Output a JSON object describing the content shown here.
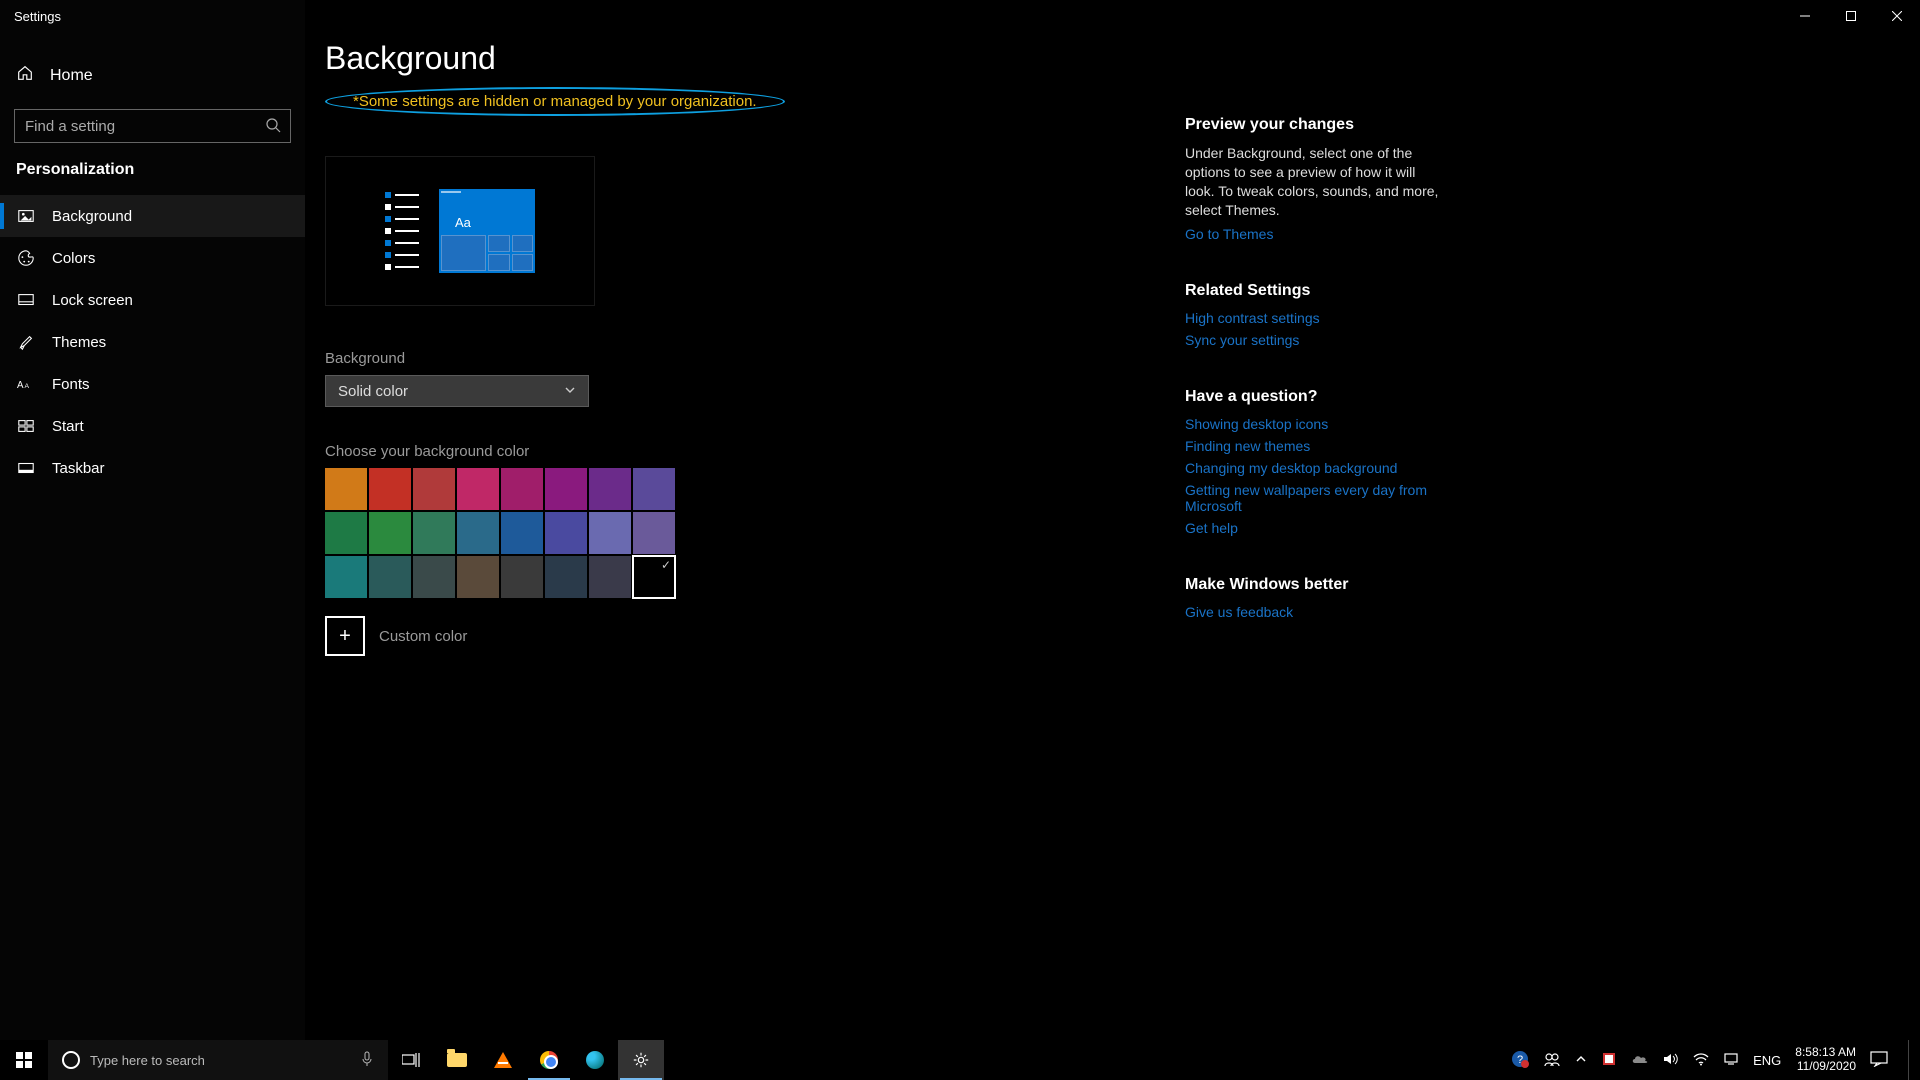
{
  "window": {
    "title": "Settings"
  },
  "sidebar": {
    "home": "Home",
    "search_placeholder": "Find a setting",
    "section": "Personalization",
    "items": [
      {
        "label": "Background"
      },
      {
        "label": "Colors"
      },
      {
        "label": "Lock screen"
      },
      {
        "label": "Themes"
      },
      {
        "label": "Fonts"
      },
      {
        "label": "Start"
      },
      {
        "label": "Taskbar"
      }
    ]
  },
  "main": {
    "title": "Background",
    "org_warning": "*Some settings are hidden or managed by your organization.",
    "preview_sample": "Aa",
    "bg_label": "Background",
    "bg_value": "Solid color",
    "swatch_label": "Choose your background color",
    "swatches": [
      "#d17a18",
      "#c33025",
      "#b03a3a",
      "#c02867",
      "#a01e6a",
      "#8a1a7e",
      "#6b2b8a",
      "#5a4a9a",
      "#1e7a45",
      "#2b8a3e",
      "#307a5a",
      "#2a6a8a",
      "#1e5a9a",
      "#4a4aa0",
      "#6a6ab0",
      "#6a5a9a",
      "#1a7a7a",
      "#2a5a5a",
      "#3a4a4a",
      "#5a4a3a",
      "#3a3a3a",
      "#2a3a4a",
      "#3a3a4a",
      "#000000"
    ],
    "selected_swatch_index": 23,
    "custom_color": "Custom color"
  },
  "right": {
    "preview_h": "Preview your changes",
    "preview_p": "Under Background, select one of the options to see a preview of how it will look. To tweak colors, sounds, and more, select Themes.",
    "themes_link": "Go to Themes",
    "related_h": "Related Settings",
    "related_links": [
      "High contrast settings",
      "Sync your settings"
    ],
    "question_h": "Have a question?",
    "question_links": [
      "Showing desktop icons",
      "Finding new themes",
      "Changing my desktop background",
      "Getting new wallpapers every day from Microsoft",
      "Get help"
    ],
    "better_h": "Make Windows better",
    "feedback_link": "Give us feedback"
  },
  "taskbar": {
    "search_placeholder": "Type here to search",
    "lang": "ENG",
    "time": "8:58:13 AM",
    "date": "11/09/2020"
  }
}
